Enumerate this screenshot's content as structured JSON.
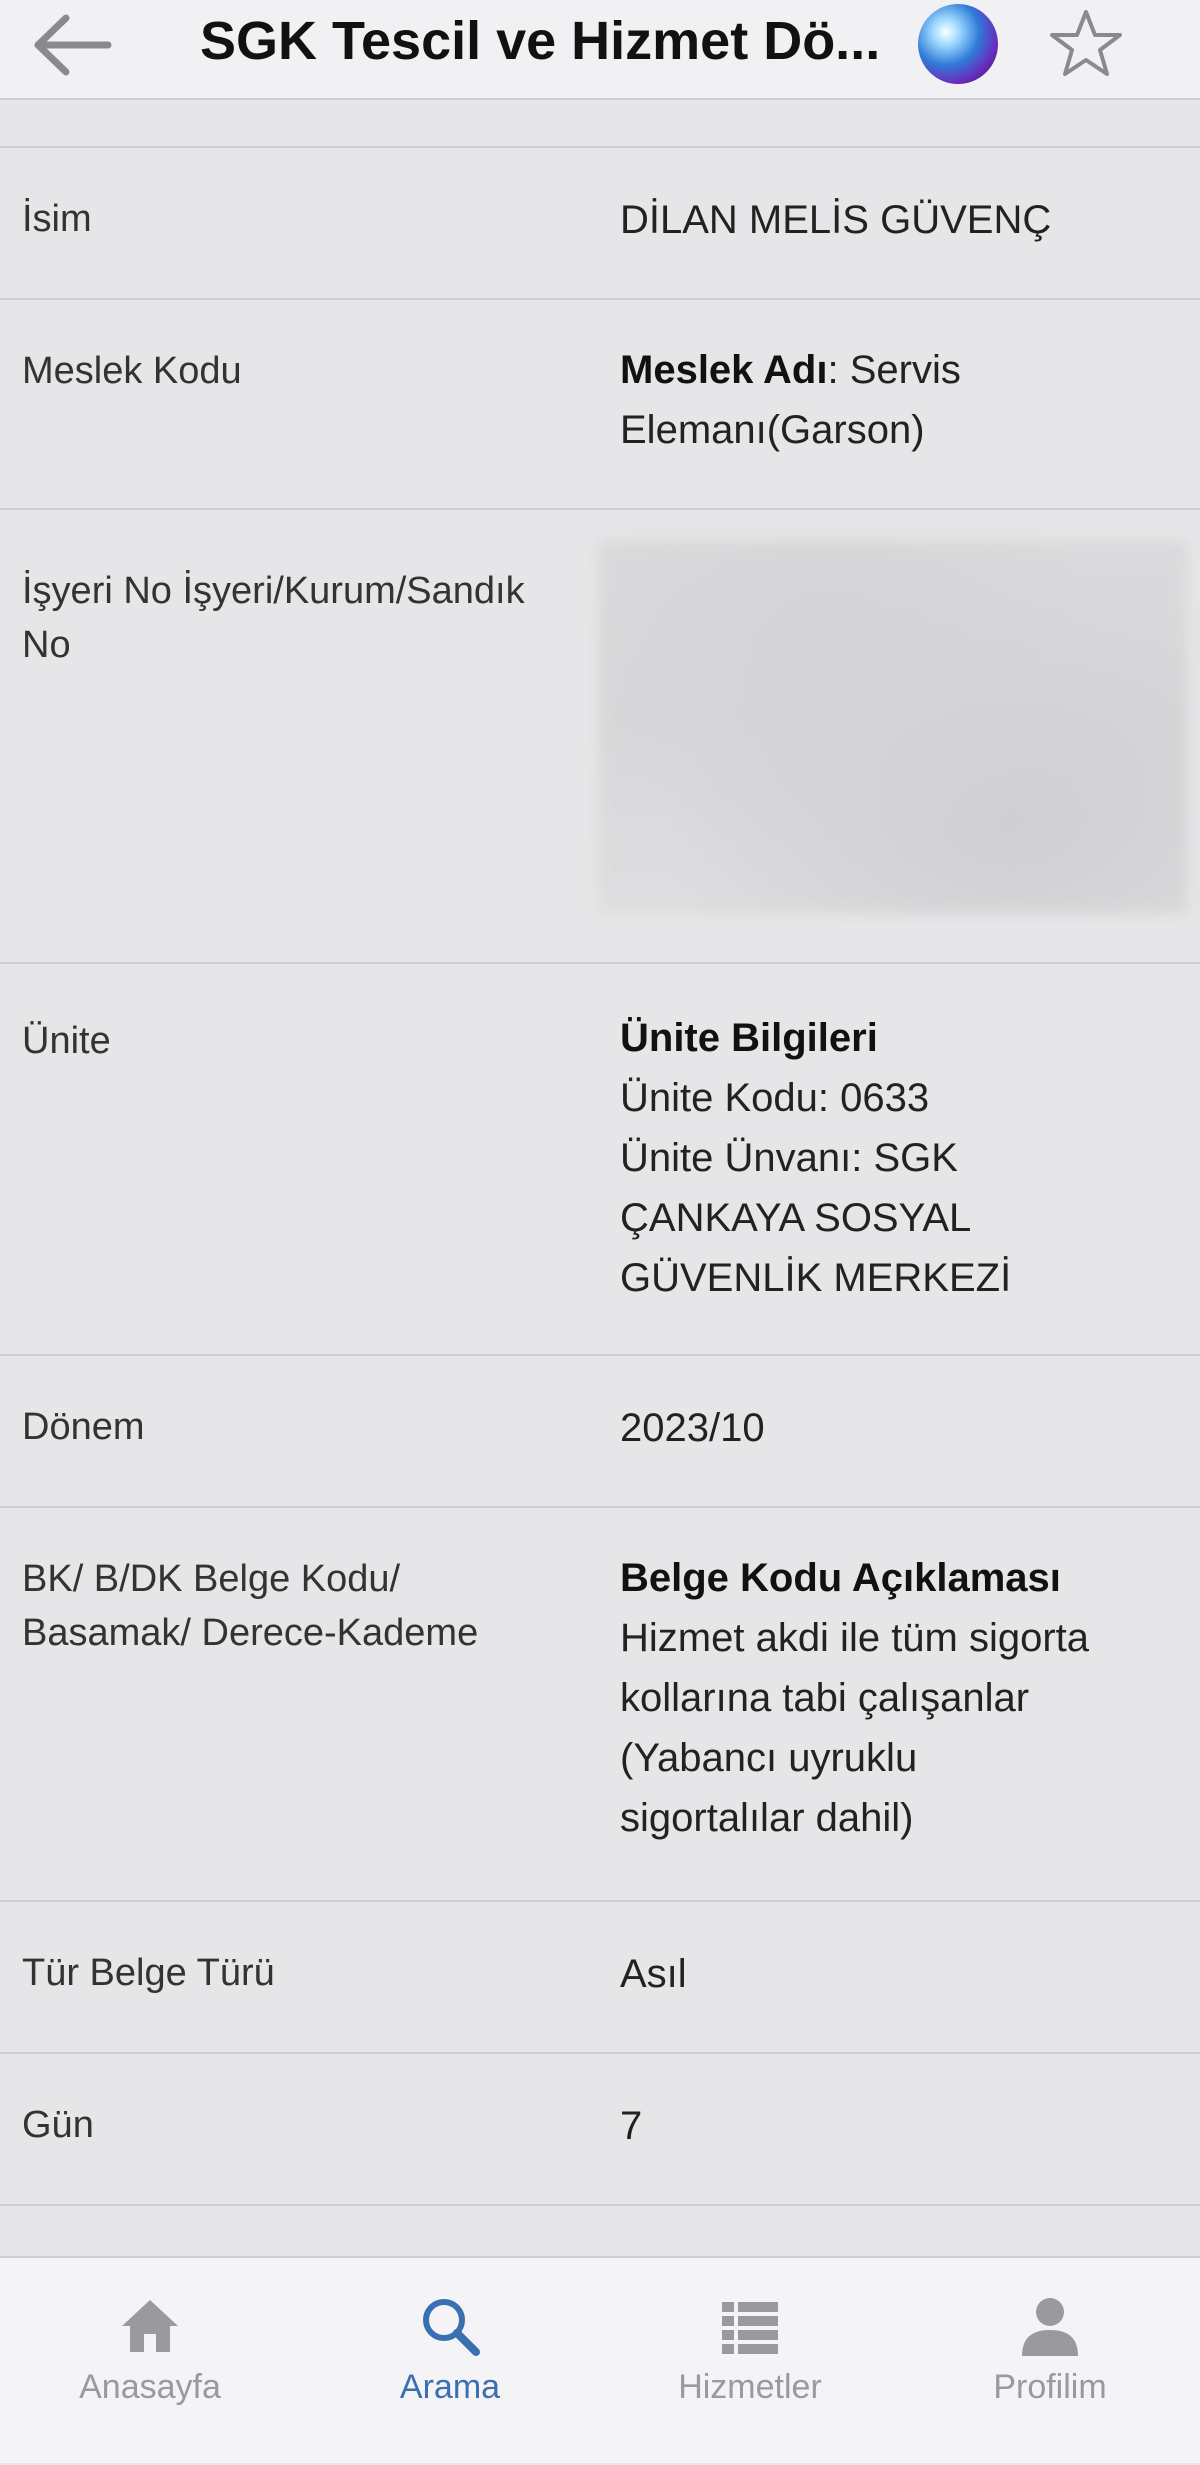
{
  "header": {
    "title": "SGK Tescil ve Hizmet Dö...",
    "back_icon": "arrow-left-icon",
    "assistant_icon": "siri-icon",
    "favorite_icon": "star-outline-icon"
  },
  "rows": [
    {
      "label": "İsim",
      "value": "DİLAN MELİS GÜVENÇ"
    },
    {
      "label": "Meslek Kodu",
      "value_bold": "Meslek Adı",
      "value_line1": ": Servis",
      "value_line2": "Elemanı(Garson)"
    },
    {
      "label_line1": "İşyeri No İşyeri/Kurum/Sandık",
      "label_line2": "No"
    },
    {
      "label": "Ünite",
      "value_bold": "Ünite Bilgileri",
      "lines": [
        "Ünite Kodu: 0633",
        "Ünite Ünvanı: SGK",
        "ÇANKAYA SOSYAL",
        "GÜVENLİK MERKEZİ"
      ]
    },
    {
      "label": "Dönem",
      "value": "2023/10"
    },
    {
      "label_line1": "BK/ B/DK Belge Kodu/",
      "label_line2": "Basamak/ Derece-Kademe",
      "value_bold": "Belge Kodu Açıklaması",
      "lines": [
        "Hizmet akdi ile tüm sigorta",
        "kollarına tabi çalışanlar",
        "(Yabancı uyruklu",
        "sigortalılar dahil)"
      ]
    },
    {
      "label": "Tür Belge Türü",
      "value": "Asıl"
    },
    {
      "label": "Gün",
      "value": "7"
    }
  ],
  "tabs": [
    {
      "label": "Anasayfa",
      "icon": "home-icon",
      "active": false
    },
    {
      "label": "Arama",
      "icon": "search-icon",
      "active": true
    },
    {
      "label": "Hizmetler",
      "icon": "list-icon",
      "active": false
    },
    {
      "label": "Profilim",
      "icon": "user-icon",
      "active": false
    }
  ],
  "colors": {
    "accent": "#3a6fb0",
    "inactive": "#9a9a9e",
    "background": "#e6e6e8"
  }
}
